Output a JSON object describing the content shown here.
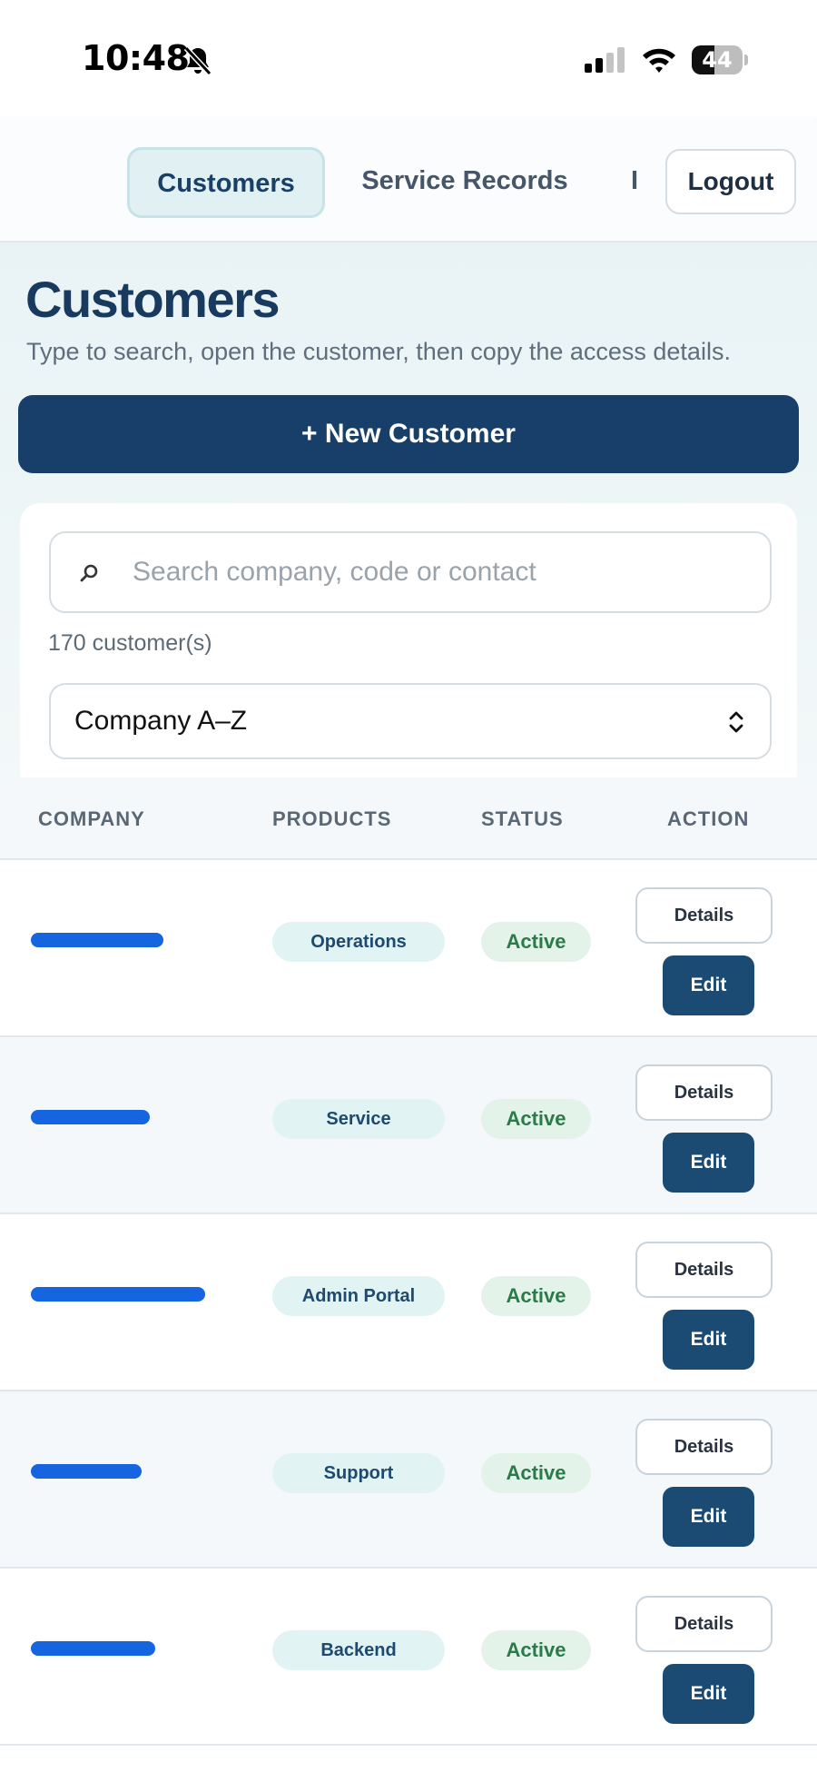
{
  "status_bar": {
    "time": "10:48",
    "battery": "44",
    "battery_level": 0.44
  },
  "nav": {
    "tabs": [
      {
        "label": "Customers",
        "active": true
      },
      {
        "label": "Service Records",
        "active": false
      },
      {
        "label": "I",
        "active": false
      }
    ],
    "logout_label": "Logout"
  },
  "page": {
    "title": "Customers",
    "subtitle": "Type to search, open the customer, then copy the access details.",
    "new_button": "+ New Customer"
  },
  "search": {
    "placeholder": "Search company, code or contact",
    "value": ""
  },
  "count_text": "170 customer(s)",
  "sort": {
    "selected": "Company A–Z"
  },
  "table": {
    "headers": [
      "COMPANY",
      "PRODUCTS",
      "STATUS",
      "ACTION"
    ],
    "rows": [
      {
        "company": "",
        "product": "Operations",
        "status": "Active",
        "details": "Details",
        "edit": "Edit"
      },
      {
        "company": "",
        "product": "Service",
        "status": "Active",
        "details": "Details",
        "edit": "Edit"
      },
      {
        "company": "",
        "product": "Admin Portal",
        "status": "Active",
        "details": "Details",
        "edit": "Edit"
      },
      {
        "company": "",
        "product": "Support",
        "status": "Active",
        "details": "Details",
        "edit": "Edit"
      },
      {
        "company": "",
        "product": "Backend",
        "status": "Active",
        "details": "Details",
        "edit": "Edit"
      }
    ]
  },
  "colors": {
    "primary": "#183f69",
    "accent_link": "#1565e0",
    "status_active": "#2a7a4a"
  },
  "icons": [
    "bell-slash-icon",
    "signal-icon",
    "wifi-icon",
    "battery-icon",
    "search-icon",
    "chevron-updown-icon"
  ]
}
